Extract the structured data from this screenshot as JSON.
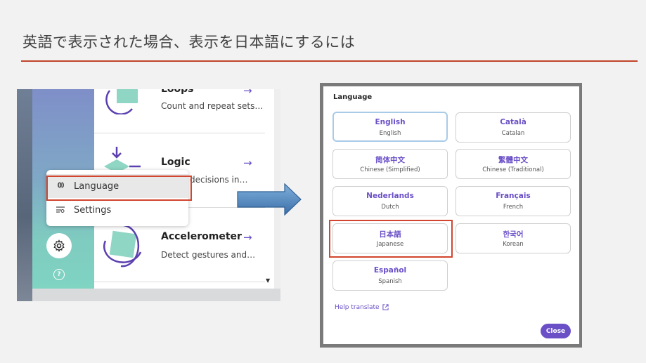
{
  "slide": {
    "title": "英語で表示された場合、表示を日本語にするには"
  },
  "colors": {
    "accent_red": "#d2452e",
    "purple": "#6a4fc7",
    "teal": "#7fd4c2"
  },
  "left_screenshot": {
    "cards": [
      {
        "title": "Loops",
        "desc": "Count and repeat sets…",
        "icon": "loops-icon"
      },
      {
        "title": "Logic",
        "desc": "decisions in…",
        "icon": "logic-icon"
      },
      {
        "title": "Accelerometer",
        "desc": "Detect gestures and…",
        "icon": "accelerometer-icon"
      }
    ],
    "menu": {
      "items": [
        {
          "label": "Language",
          "icon": "globe-icon"
        },
        {
          "label": "Settings",
          "icon": "settings-sliders-icon"
        }
      ]
    },
    "help_glyph": "?",
    "card_arrow": "→"
  },
  "dialog": {
    "title": "Language",
    "languages": [
      {
        "native": "English",
        "english": "English"
      },
      {
        "native": "Català",
        "english": "Catalan"
      },
      {
        "native": "简体中文",
        "english": "Chinese (Simplified)"
      },
      {
        "native": "繁體中文",
        "english": "Chinese (Traditional)"
      },
      {
        "native": "Nederlands",
        "english": "Dutch"
      },
      {
        "native": "Français",
        "english": "French"
      },
      {
        "native": "日本語",
        "english": "Japanese"
      },
      {
        "native": "한국어",
        "english": "Korean"
      },
      {
        "native": "Español",
        "english": "Spanish"
      }
    ],
    "help_link": "Help translate",
    "close_label": "Close"
  }
}
